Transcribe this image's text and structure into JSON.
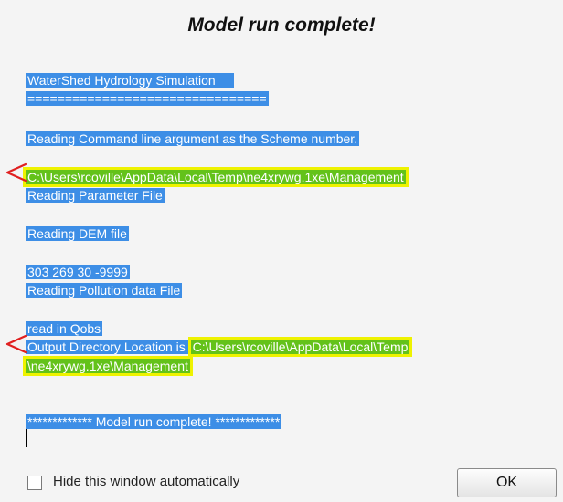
{
  "window": {
    "title": "Model run complete!"
  },
  "log": {
    "lines": [
      "WaterShed Hydrology Simulation",
      "================================",
      "Reading Command line argument as the Scheme number.",
      "C:\\Users\\rcoville\\AppData\\Local\\Temp\\ne4xrywg.1xe\\Management",
      "Reading Parameter File",
      "Reading DEM file",
      "303 269 30 -9999",
      "Reading Pollution data File",
      "read in Qobs",
      "Output Directory Location is ",
      "C:\\Users\\rcoville\\AppData\\Local\\Temp",
      "\\ne4xrywg.1xe\\Management",
      "************* Model run complete! *************"
    ]
  },
  "footer": {
    "hide_label": "Hide this window automatically",
    "ok_label": "OK"
  },
  "colors": {
    "selection": "#3d8ee6",
    "highlight_green": "#63c21a",
    "highlight_yellow": "#eef200",
    "marker_red": "#e02020"
  }
}
